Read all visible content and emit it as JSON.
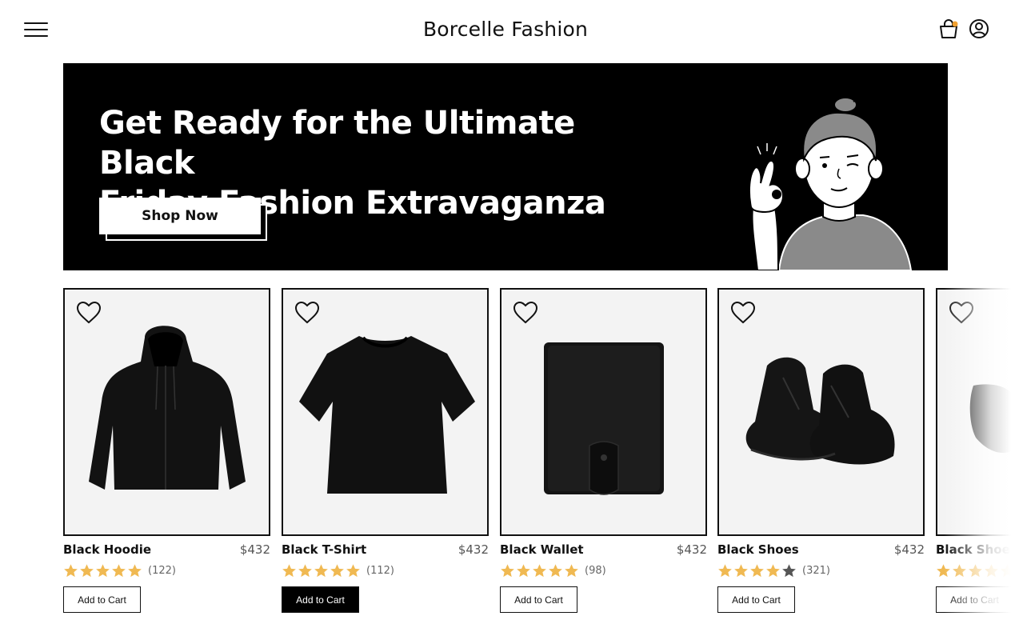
{
  "header": {
    "brand": "Borcelle Fashion"
  },
  "banner": {
    "title_line1": "Get Ready for the Ultimate Black",
    "title_line2": "Friday Fashion Extravaganza",
    "cta_label": "Shop Now"
  },
  "colors": {
    "accent_star": "#F0B952",
    "star_empty": "#555555",
    "banner_bg": "#000000",
    "notification_dot": "#F0A030"
  },
  "products": [
    {
      "name": "Black Hoodie",
      "price": "$432",
      "rating": 5,
      "count": "(122)",
      "cart_label": "Add to Cart",
      "image": "hoodie",
      "cart_active": false
    },
    {
      "name": "Black T-Shirt",
      "price": "$432",
      "rating": 5,
      "count": "(112)",
      "cart_label": "Add to Cart",
      "image": "tshirt",
      "cart_active": true
    },
    {
      "name": "Black Wallet",
      "price": "$432",
      "rating": 5,
      "count": "(98)",
      "cart_label": "Add to Cart",
      "image": "wallet",
      "cart_active": false
    },
    {
      "name": "Black Shoes",
      "price": "$432",
      "rating": 4,
      "count": "(321)",
      "cart_label": "Add to Cart",
      "image": "shoes",
      "cart_active": false
    },
    {
      "name": "Black Shoes",
      "price": "",
      "rating": 5,
      "count": "",
      "cart_label": "Add to Cart",
      "image": "sunglasses",
      "cart_active": false
    }
  ]
}
